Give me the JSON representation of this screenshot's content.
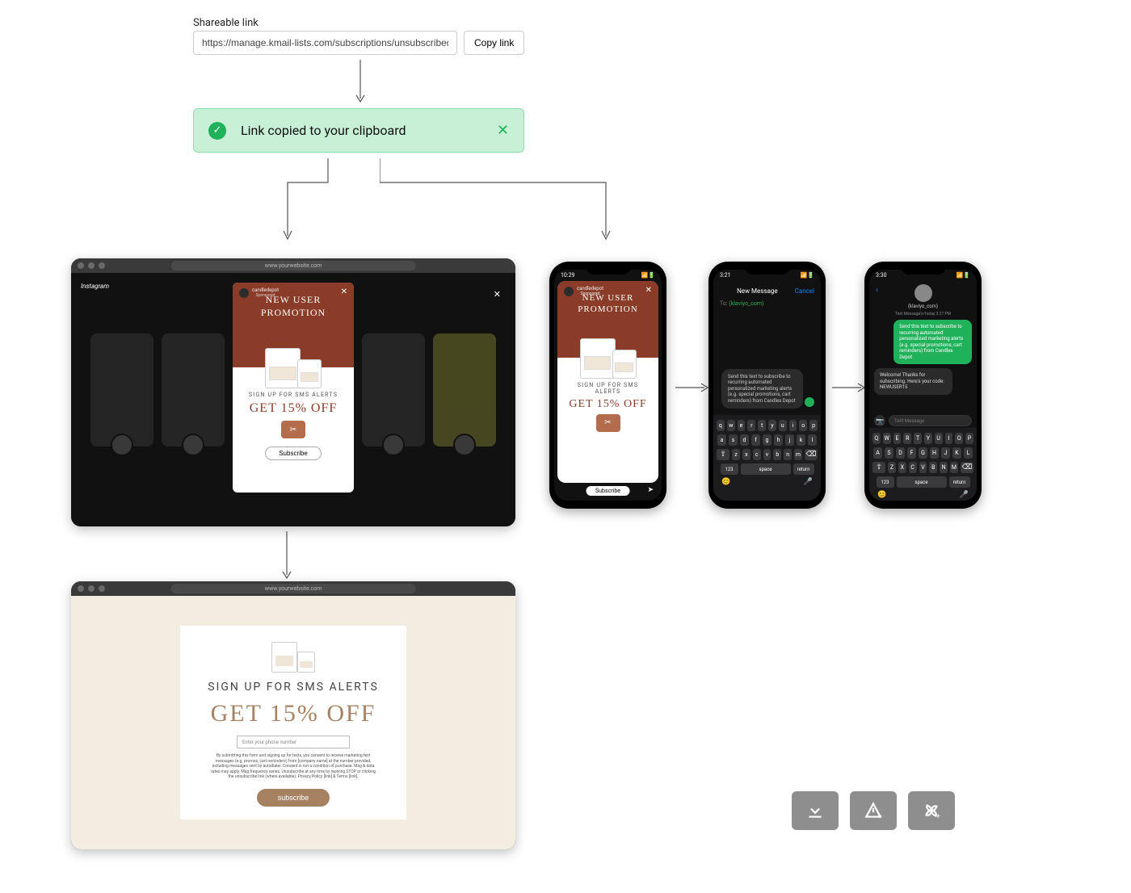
{
  "share": {
    "label": "Shareable link",
    "value": "https://manage.kmail-lists.com/subscriptions/unsubscribed?...",
    "copy_button": "Copy link"
  },
  "toast": {
    "message": "Link copied to your clipboard"
  },
  "browser1": {
    "url": "www.yourwebsite.com",
    "ig_label": "Instagram"
  },
  "promo": {
    "brand": "candledepot",
    "sponsored": "Sponsored",
    "title_line1": "NEW USER",
    "title_line2": "PROMOTION",
    "sms": "SIGN UP FOR SMS ALERTS",
    "off": "GET 15% OFF",
    "coupon": "✂",
    "subscribe": "Subscribe"
  },
  "phone1": {
    "time": "10:29",
    "footer_btn": "Subscribe"
  },
  "phone2": {
    "time": "3:21",
    "header_title": "New Message",
    "header_cancel": "Cancel",
    "to_label": "To:",
    "recipient": "(klaviyo_com)",
    "compose_text": "Send this text to subscribe to recurring automated personalized marketing alerts (e.g. special promotions, cart reminders) from Candles Depot",
    "kbd_upper": false
  },
  "phone3": {
    "time": "3:30",
    "contact_name": "(klaviyo_com)",
    "timestamp": "Text Message\\nToday 3:21 PM",
    "msg_out": "Send this text to subscribe to recurring automated personalized marketing alerts (e.g. special promotions, cart reminders) from Candles Depot",
    "msg_in": "Welcome! Thanks for subscribing. Here's your code: NEWUSER15",
    "input_placeholder": "Text Message"
  },
  "browser2": {
    "url": "www.yourwebsite.com"
  },
  "landing": {
    "sms": "SIGN UP FOR SMS ALERTS",
    "off": "GET 15% OFF",
    "phone_placeholder": "Enter your phone number",
    "legal": "By submitting this form and signing up for texts, you consent to receive marketing text messages (e.g. promos, cart reminders) from [company name] at the number provided, including messages sent by autodialer. Consent is not a condition of purchase. Msg & data rates may apply. Msg frequency varies. Unsubscribe at any time by replying STOP or clicking the unsubscribe link (where available). Privacy Policy [link] & Terms [link].",
    "subscribe": "subscribe"
  },
  "keyboard": {
    "row1_lower": [
      "q",
      "w",
      "e",
      "r",
      "t",
      "y",
      "u",
      "i",
      "o",
      "p"
    ],
    "row2_lower": [
      "a",
      "s",
      "d",
      "f",
      "g",
      "h",
      "j",
      "k",
      "l"
    ],
    "row3_lower": [
      "z",
      "x",
      "c",
      "v",
      "b",
      "n",
      "m"
    ],
    "row1_upper": [
      "Q",
      "W",
      "E",
      "R",
      "T",
      "Y",
      "U",
      "I",
      "O",
      "P"
    ],
    "row2_upper": [
      "A",
      "S",
      "D",
      "F",
      "G",
      "H",
      "J",
      "K",
      "L"
    ],
    "row3_upper": [
      "Z",
      "X",
      "C",
      "V",
      "B",
      "N",
      "M"
    ],
    "num_key": "123",
    "space": "space",
    "return": "return"
  },
  "toolbar": {
    "download": "download",
    "add_note": "add-note",
    "add_pinwheel": "add-pinwheel"
  }
}
